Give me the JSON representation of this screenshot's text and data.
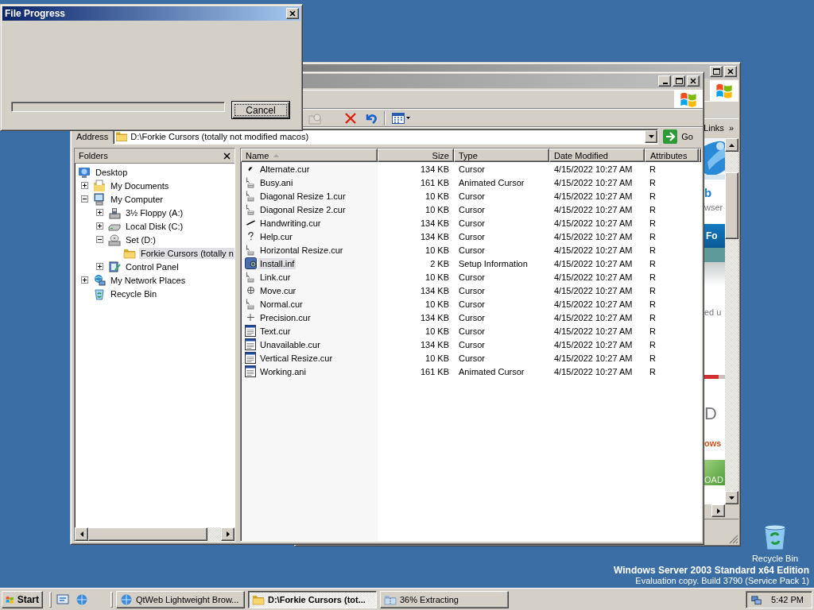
{
  "progress_dialog": {
    "title": "File Progress",
    "level": 0,
    "cancel_label": "Cancel"
  },
  "browser_window": {
    "links_label": "Links",
    "links_chevron": "»",
    "page_fragments": [
      {
        "kind": "logo",
        "text": "b"
      },
      {
        "kind": "text",
        "text": "wser"
      },
      {
        "kind": "banner",
        "text": "Fo"
      },
      {
        "kind": "text",
        "text": "ed u"
      },
      {
        "kind": "heading",
        "text": "D"
      },
      {
        "kind": "accent",
        "text": "ows"
      },
      {
        "kind": "button",
        "text": "OAD"
      }
    ]
  },
  "explorer_window": {
    "address_label": "Address",
    "address": "D:\\Forkie Cursors (totally not modified macos)",
    "go_label": "Go",
    "folders_title": "Folders",
    "folder_tree": [
      {
        "label": "Desktop",
        "kind": "desktop",
        "selected": false,
        "children": [
          {
            "label": "My Documents",
            "kind": "documents",
            "expandable": true,
            "expanded": false,
            "selected": false
          },
          {
            "label": "My Computer",
            "kind": "computer",
            "expandable": true,
            "expanded": true,
            "selected": false,
            "children": [
              {
                "label": "3½ Floppy (A:)",
                "kind": "floppy",
                "expandable": true,
                "expanded": false,
                "selected": false
              },
              {
                "label": "Local Disk (C:)",
                "kind": "disk",
                "expandable": true,
                "expanded": false,
                "selected": false
              },
              {
                "label": "Set (D:)",
                "kind": "cd",
                "expandable": true,
                "expanded": true,
                "selected": false,
                "children": [
                  {
                    "label": "Forkie Cursors (totally n",
                    "kind": "folder",
                    "expandable": false,
                    "selected": true
                  }
                ]
              },
              {
                "label": "Control Panel",
                "kind": "control",
                "expandable": true,
                "expanded": false,
                "selected": false
              }
            ]
          },
          {
            "label": "My Network Places",
            "kind": "network",
            "expandable": true,
            "expanded": false,
            "selected": false
          },
          {
            "label": "Recycle Bin",
            "kind": "recycle",
            "expandable": false,
            "selected": false
          }
        ]
      }
    ],
    "columns": [
      {
        "label": "Name",
        "sorted": true
      },
      {
        "label": "Size",
        "sorted": false
      },
      {
        "label": "Type",
        "sorted": false
      },
      {
        "label": "Date Modified",
        "sorted": false
      },
      {
        "label": "Attributes",
        "sorted": false
      }
    ],
    "files": [
      {
        "name": "Alternate.cur",
        "size": "134 KB",
        "type": "Cursor",
        "date": "4/15/2022 10:27 AM",
        "attributes": "R",
        "kind": "pointer",
        "selected": false
      },
      {
        "name": "Busy.ani",
        "size": "161 KB",
        "type": "Animated Cursor",
        "date": "4/15/2022 10:27 AM",
        "attributes": "R",
        "kind": "arrow",
        "selected": false
      },
      {
        "name": "Diagonal Resize 1.cur",
        "size": "10 KB",
        "type": "Cursor",
        "date": "4/15/2022 10:27 AM",
        "attributes": "R",
        "kind": "arrow",
        "selected": false
      },
      {
        "name": "Diagonal Resize 2.cur",
        "size": "10 KB",
        "type": "Cursor",
        "date": "4/15/2022 10:27 AM",
        "attributes": "R",
        "kind": "arrow",
        "selected": false
      },
      {
        "name": "Handwriting.cur",
        "size": "134 KB",
        "type": "Cursor",
        "date": "4/15/2022 10:27 AM",
        "attributes": "R",
        "kind": "pen",
        "selected": false
      },
      {
        "name": "Help.cur",
        "size": "134 KB",
        "type": "Cursor",
        "date": "4/15/2022 10:27 AM",
        "attributes": "R",
        "kind": "help",
        "selected": false
      },
      {
        "name": "Horizontal Resize.cur",
        "size": "10 KB",
        "type": "Cursor",
        "date": "4/15/2022 10:27 AM",
        "attributes": "R",
        "kind": "arrow",
        "selected": false
      },
      {
        "name": "Install.inf",
        "size": "2 KB",
        "type": "Setup Information",
        "date": "4/15/2022 10:27 AM",
        "attributes": "R",
        "kind": "setup",
        "selected": true
      },
      {
        "name": "Link.cur",
        "size": "10 KB",
        "type": "Cursor",
        "date": "4/15/2022 10:27 AM",
        "attributes": "R",
        "kind": "arrow",
        "selected": false
      },
      {
        "name": "Move.cur",
        "size": "134 KB",
        "type": "Cursor",
        "date": "4/15/2022 10:27 AM",
        "attributes": "R",
        "kind": "move",
        "selected": false
      },
      {
        "name": "Normal.cur",
        "size": "10 KB",
        "type": "Cursor",
        "date": "4/15/2022 10:27 AM",
        "attributes": "R",
        "kind": "arrow",
        "selected": false
      },
      {
        "name": "Precision.cur",
        "size": "134 KB",
        "type": "Cursor",
        "date": "4/15/2022 10:27 AM",
        "attributes": "R",
        "kind": "cross",
        "selected": false
      },
      {
        "name": "Text.cur",
        "size": "10 KB",
        "type": "Cursor",
        "date": "4/15/2022 10:27 AM",
        "attributes": "R",
        "kind": "window",
        "selected": false
      },
      {
        "name": "Unavailable.cur",
        "size": "134 KB",
        "type": "Cursor",
        "date": "4/15/2022 10:27 AM",
        "attributes": "R",
        "kind": "window",
        "selected": false
      },
      {
        "name": "Vertical Resize.cur",
        "size": "10 KB",
        "type": "Cursor",
        "date": "4/15/2022 10:27 AM",
        "attributes": "R",
        "kind": "window",
        "selected": false
      },
      {
        "name": "Working.ani",
        "size": "161 KB",
        "type": "Animated Cursor",
        "date": "4/15/2022 10:27 AM",
        "attributes": "R",
        "kind": "window",
        "selected": false
      }
    ]
  },
  "desktop": {
    "icons": [
      {
        "label": "Recycle Bin"
      }
    ],
    "os_edition": "Windows Server 2003 Standard x64 Edition",
    "build_info": "Evaluation copy. Build 3790 (Service Pack 1)"
  },
  "taskbar": {
    "start_label": "Start",
    "tasks": [
      {
        "label": "QtWeb Lightweight Brow...",
        "kind": "browser",
        "selected": false
      },
      {
        "label": "D:\\Forkie Cursors (tot...",
        "kind": "folder",
        "selected": true
      },
      {
        "label": "36% Extracting",
        "kind": "extract",
        "selected": false
      }
    ],
    "clock": "5:42 PM"
  }
}
